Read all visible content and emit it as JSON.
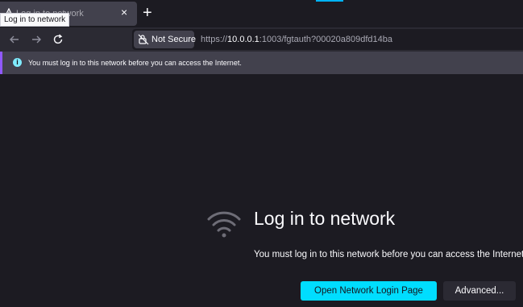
{
  "tab": {
    "title": "Log in to network",
    "close_icon": "close-icon"
  },
  "new_tab_label": "+",
  "tooltip": "Log in to network",
  "navbar": {
    "back_icon": "arrow-left-icon",
    "forward_icon": "arrow-right-icon",
    "reload_icon": "reload-icon",
    "security_label": "Not Secure",
    "url_prefix": "https://",
    "url_host": "10.0.0.1",
    "url_rest": ":1003/fgtauth?00020a809dfd14ba"
  },
  "infobar": {
    "icon": "info-icon",
    "text": "You must log in to this network before you can access the Internet."
  },
  "main": {
    "icon": "wifi-icon",
    "title": "Log in to network",
    "description": "You must log in to this network before you can access the Internet.",
    "login_button": "Open Network Login Page",
    "advanced_button": "Advanced..."
  },
  "colors": {
    "accent": "#00ddff",
    "infobar_stripe": "#9059ff",
    "background": "#1c1b22"
  }
}
